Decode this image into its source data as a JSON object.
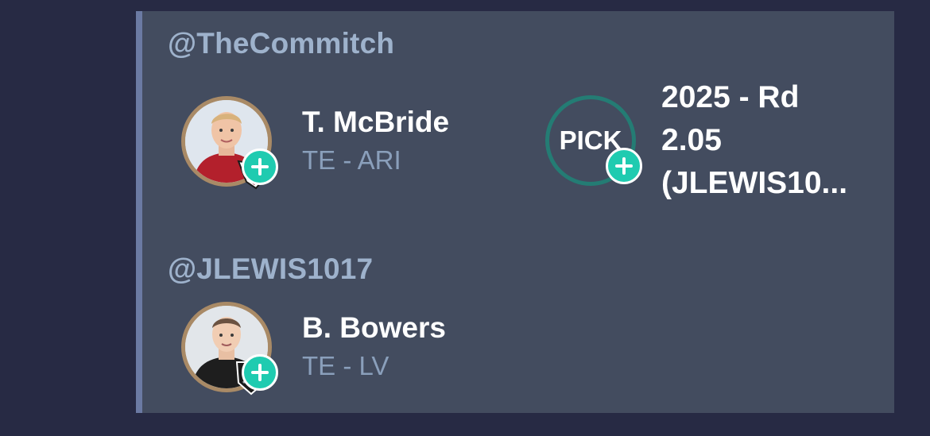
{
  "groups": [
    {
      "handle": "@TheCommitch",
      "player": {
        "name": "T. McBride",
        "position": "TE - ARI",
        "team_logo": "cardinals-logo-icon"
      },
      "pick": {
        "badge": "PICK",
        "line1": "2025 - Rd",
        "line2": "2.05",
        "line3": "(JLEWIS10..."
      }
    },
    {
      "handle": "@JLEWIS1017",
      "player": {
        "name": "B. Bowers",
        "position": "TE - LV",
        "team_logo": "raiders-logo-icon"
      }
    }
  ],
  "colors": {
    "background": "#272a44",
    "card": "#434c5f",
    "accent_bar": "#6b7aa3",
    "handle": "#9eb2cc",
    "add": "#1fcbb0",
    "pick_ring": "#247c74",
    "avatar_ring": "#a98a66"
  }
}
